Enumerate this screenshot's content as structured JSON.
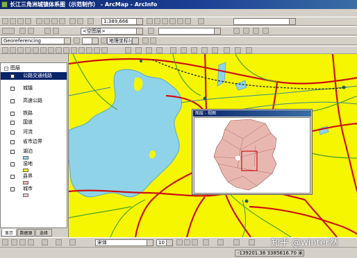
{
  "window": {
    "title": "长江三角洲城镇体系图（示范制作） - ArcMap - ArcInfo"
  },
  "toolbar1": {
    "scale_value": "1:389,666"
  },
  "toolbar2": {
    "label_placeholder": "<空图层>"
  },
  "toolbar3": {
    "geo_label": "Georeferencing",
    "layer_dropdown": "地理坐标(g)"
  },
  "toc": {
    "root_label": "图层",
    "layers": [
      {
        "label": "公路交通线路",
        "selected": true
      },
      {
        "label": "城镇"
      },
      {
        "label": "高速公路"
      },
      {
        "label": "铁路"
      },
      {
        "label": "国道"
      },
      {
        "label": "河流"
      },
      {
        "label": "省市边界"
      },
      {
        "label": "湖泊"
      },
      {
        "label": "湿地"
      },
      {
        "label": "县界"
      },
      {
        "label": "城市"
      }
    ],
    "tabs": [
      "显示",
      "数据源",
      "选择"
    ]
  },
  "overview": {
    "title": "图层 - 视图"
  },
  "bottom_toolbar": {
    "font_name": "宋体",
    "font_size": "10"
  },
  "status": {
    "coords": "-139201.38 3385616.70 米"
  },
  "watermark": "知乎 @winter然",
  "colors": {
    "land": "#f6f600",
    "water": "#8fd3e8",
    "road_red": "#cc1111",
    "road_green": "#4aa02a",
    "river": "#3c8a8a"
  }
}
